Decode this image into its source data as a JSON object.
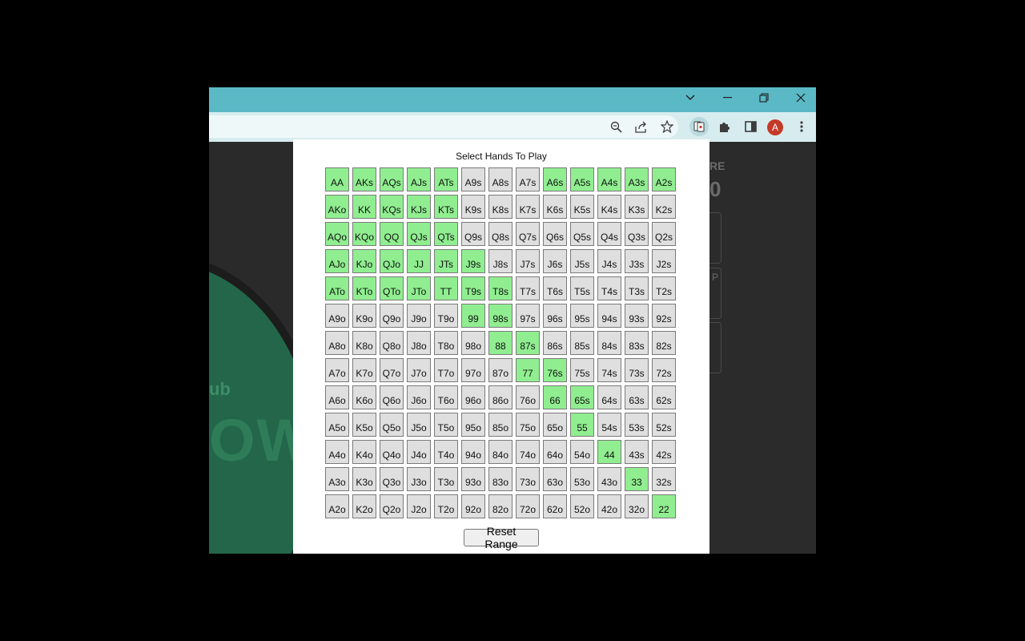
{
  "popup": {
    "heading": "Select Hands To Play",
    "reset_label": "Reset Range"
  },
  "avatar_letter": "A",
  "background_fragments": {
    "felt_text_small": "ub",
    "felt_text_large": "OW",
    "side_label": "RE",
    "side_value": "0",
    "side_small": "P"
  },
  "colors": {
    "selected": "#90ee90",
    "unselected": "#dfdfdf",
    "titlebar": "#5bb9c6"
  },
  "hands": [
    {
      "label": "AA",
      "selected": true
    },
    {
      "label": "AKs",
      "selected": true
    },
    {
      "label": "AQs",
      "selected": true
    },
    {
      "label": "AJs",
      "selected": true
    },
    {
      "label": "ATs",
      "selected": true
    },
    {
      "label": "A9s",
      "selected": false
    },
    {
      "label": "A8s",
      "selected": false
    },
    {
      "label": "A7s",
      "selected": false
    },
    {
      "label": "A6s",
      "selected": true
    },
    {
      "label": "A5s",
      "selected": true
    },
    {
      "label": "A4s",
      "selected": true
    },
    {
      "label": "A3s",
      "selected": true
    },
    {
      "label": "A2s",
      "selected": true
    },
    {
      "label": "AKo",
      "selected": true
    },
    {
      "label": "KK",
      "selected": true
    },
    {
      "label": "KQs",
      "selected": true
    },
    {
      "label": "KJs",
      "selected": true
    },
    {
      "label": "KTs",
      "selected": true
    },
    {
      "label": "K9s",
      "selected": false
    },
    {
      "label": "K8s",
      "selected": false
    },
    {
      "label": "K7s",
      "selected": false
    },
    {
      "label": "K6s",
      "selected": false
    },
    {
      "label": "K5s",
      "selected": false
    },
    {
      "label": "K4s",
      "selected": false
    },
    {
      "label": "K3s",
      "selected": false
    },
    {
      "label": "K2s",
      "selected": false
    },
    {
      "label": "AQo",
      "selected": true
    },
    {
      "label": "KQo",
      "selected": true
    },
    {
      "label": "QQ",
      "selected": true
    },
    {
      "label": "QJs",
      "selected": true
    },
    {
      "label": "QTs",
      "selected": true
    },
    {
      "label": "Q9s",
      "selected": false
    },
    {
      "label": "Q8s",
      "selected": false
    },
    {
      "label": "Q7s",
      "selected": false
    },
    {
      "label": "Q6s",
      "selected": false
    },
    {
      "label": "Q5s",
      "selected": false
    },
    {
      "label": "Q4s",
      "selected": false
    },
    {
      "label": "Q3s",
      "selected": false
    },
    {
      "label": "Q2s",
      "selected": false
    },
    {
      "label": "AJo",
      "selected": true
    },
    {
      "label": "KJo",
      "selected": true
    },
    {
      "label": "QJo",
      "selected": true
    },
    {
      "label": "JJ",
      "selected": true
    },
    {
      "label": "JTs",
      "selected": true
    },
    {
      "label": "J9s",
      "selected": true
    },
    {
      "label": "J8s",
      "selected": false
    },
    {
      "label": "J7s",
      "selected": false
    },
    {
      "label": "J6s",
      "selected": false
    },
    {
      "label": "J5s",
      "selected": false
    },
    {
      "label": "J4s",
      "selected": false
    },
    {
      "label": "J3s",
      "selected": false
    },
    {
      "label": "J2s",
      "selected": false
    },
    {
      "label": "ATo",
      "selected": true
    },
    {
      "label": "KTo",
      "selected": true
    },
    {
      "label": "QTo",
      "selected": true
    },
    {
      "label": "JTo",
      "selected": true
    },
    {
      "label": "TT",
      "selected": true
    },
    {
      "label": "T9s",
      "selected": true
    },
    {
      "label": "T8s",
      "selected": true
    },
    {
      "label": "T7s",
      "selected": false
    },
    {
      "label": "T6s",
      "selected": false
    },
    {
      "label": "T5s",
      "selected": false
    },
    {
      "label": "T4s",
      "selected": false
    },
    {
      "label": "T3s",
      "selected": false
    },
    {
      "label": "T2s",
      "selected": false
    },
    {
      "label": "A9o",
      "selected": false
    },
    {
      "label": "K9o",
      "selected": false
    },
    {
      "label": "Q9o",
      "selected": false
    },
    {
      "label": "J9o",
      "selected": false
    },
    {
      "label": "T9o",
      "selected": false
    },
    {
      "label": "99",
      "selected": true
    },
    {
      "label": "98s",
      "selected": true
    },
    {
      "label": "97s",
      "selected": false
    },
    {
      "label": "96s",
      "selected": false
    },
    {
      "label": "95s",
      "selected": false
    },
    {
      "label": "94s",
      "selected": false
    },
    {
      "label": "93s",
      "selected": false
    },
    {
      "label": "92s",
      "selected": false
    },
    {
      "label": "A8o",
      "selected": false
    },
    {
      "label": "K8o",
      "selected": false
    },
    {
      "label": "Q8o",
      "selected": false
    },
    {
      "label": "J8o",
      "selected": false
    },
    {
      "label": "T8o",
      "selected": false
    },
    {
      "label": "98o",
      "selected": false
    },
    {
      "label": "88",
      "selected": true
    },
    {
      "label": "87s",
      "selected": true
    },
    {
      "label": "86s",
      "selected": false
    },
    {
      "label": "85s",
      "selected": false
    },
    {
      "label": "84s",
      "selected": false
    },
    {
      "label": "83s",
      "selected": false
    },
    {
      "label": "82s",
      "selected": false
    },
    {
      "label": "A7o",
      "selected": false
    },
    {
      "label": "K7o",
      "selected": false
    },
    {
      "label": "Q7o",
      "selected": false
    },
    {
      "label": "J7o",
      "selected": false
    },
    {
      "label": "T7o",
      "selected": false
    },
    {
      "label": "97o",
      "selected": false
    },
    {
      "label": "87o",
      "selected": false
    },
    {
      "label": "77",
      "selected": true
    },
    {
      "label": "76s",
      "selected": true
    },
    {
      "label": "75s",
      "selected": false
    },
    {
      "label": "74s",
      "selected": false
    },
    {
      "label": "73s",
      "selected": false
    },
    {
      "label": "72s",
      "selected": false
    },
    {
      "label": "A6o",
      "selected": false
    },
    {
      "label": "K6o",
      "selected": false
    },
    {
      "label": "Q6o",
      "selected": false
    },
    {
      "label": "J6o",
      "selected": false
    },
    {
      "label": "T6o",
      "selected": false
    },
    {
      "label": "96o",
      "selected": false
    },
    {
      "label": "86o",
      "selected": false
    },
    {
      "label": "76o",
      "selected": false
    },
    {
      "label": "66",
      "selected": true
    },
    {
      "label": "65s",
      "selected": true
    },
    {
      "label": "64s",
      "selected": false
    },
    {
      "label": "63s",
      "selected": false
    },
    {
      "label": "62s",
      "selected": false
    },
    {
      "label": "A5o",
      "selected": false
    },
    {
      "label": "K5o",
      "selected": false
    },
    {
      "label": "Q5o",
      "selected": false
    },
    {
      "label": "J5o",
      "selected": false
    },
    {
      "label": "T5o",
      "selected": false
    },
    {
      "label": "95o",
      "selected": false
    },
    {
      "label": "85o",
      "selected": false
    },
    {
      "label": "75o",
      "selected": false
    },
    {
      "label": "65o",
      "selected": false
    },
    {
      "label": "55",
      "selected": true
    },
    {
      "label": "54s",
      "selected": false
    },
    {
      "label": "53s",
      "selected": false
    },
    {
      "label": "52s",
      "selected": false
    },
    {
      "label": "A4o",
      "selected": false
    },
    {
      "label": "K4o",
      "selected": false
    },
    {
      "label": "Q4o",
      "selected": false
    },
    {
      "label": "J4o",
      "selected": false
    },
    {
      "label": "T4o",
      "selected": false
    },
    {
      "label": "94o",
      "selected": false
    },
    {
      "label": "84o",
      "selected": false
    },
    {
      "label": "74o",
      "selected": false
    },
    {
      "label": "64o",
      "selected": false
    },
    {
      "label": "54o",
      "selected": false
    },
    {
      "label": "44",
      "selected": true
    },
    {
      "label": "43s",
      "selected": false
    },
    {
      "label": "42s",
      "selected": false
    },
    {
      "label": "A3o",
      "selected": false
    },
    {
      "label": "K3o",
      "selected": false
    },
    {
      "label": "Q3o",
      "selected": false
    },
    {
      "label": "J3o",
      "selected": false
    },
    {
      "label": "T3o",
      "selected": false
    },
    {
      "label": "93o",
      "selected": false
    },
    {
      "label": "83o",
      "selected": false
    },
    {
      "label": "73o",
      "selected": false
    },
    {
      "label": "63o",
      "selected": false
    },
    {
      "label": "53o",
      "selected": false
    },
    {
      "label": "43o",
      "selected": false
    },
    {
      "label": "33",
      "selected": true
    },
    {
      "label": "32s",
      "selected": false
    },
    {
      "label": "A2o",
      "selected": false
    },
    {
      "label": "K2o",
      "selected": false
    },
    {
      "label": "Q2o",
      "selected": false
    },
    {
      "label": "J2o",
      "selected": false
    },
    {
      "label": "T2o",
      "selected": false
    },
    {
      "label": "92o",
      "selected": false
    },
    {
      "label": "82o",
      "selected": false
    },
    {
      "label": "72o",
      "selected": false
    },
    {
      "label": "62o",
      "selected": false
    },
    {
      "label": "52o",
      "selected": false
    },
    {
      "label": "42o",
      "selected": false
    },
    {
      "label": "32o",
      "selected": false
    },
    {
      "label": "22",
      "selected": true
    }
  ]
}
